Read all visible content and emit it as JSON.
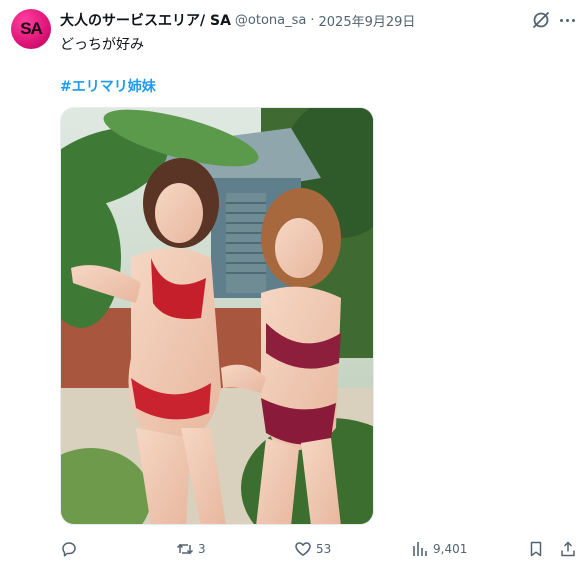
{
  "account": {
    "display_name": "大人のサービスエリア/ SA",
    "handle": "@otona_sa",
    "separator": "·",
    "date": "2025年9月29日",
    "avatar_text": "SA"
  },
  "post": {
    "text": "どっちが好み",
    "hashtag": "#エリマリ姉妹"
  },
  "icons": {
    "grok": "grok-icon",
    "more": "more-icon",
    "reply": "reply-icon",
    "repost": "repost-icon",
    "like": "like-icon",
    "views": "views-icon",
    "bookmark": "bookmark-icon",
    "share": "share-icon"
  },
  "metrics": {
    "reposts": "3",
    "likes": "53",
    "views": "9,401"
  },
  "colors": {
    "accent": "#1d9bf0",
    "secondary_text": "#536471",
    "primary_text": "#0f1419",
    "avatar_bg": "#e0187a"
  }
}
